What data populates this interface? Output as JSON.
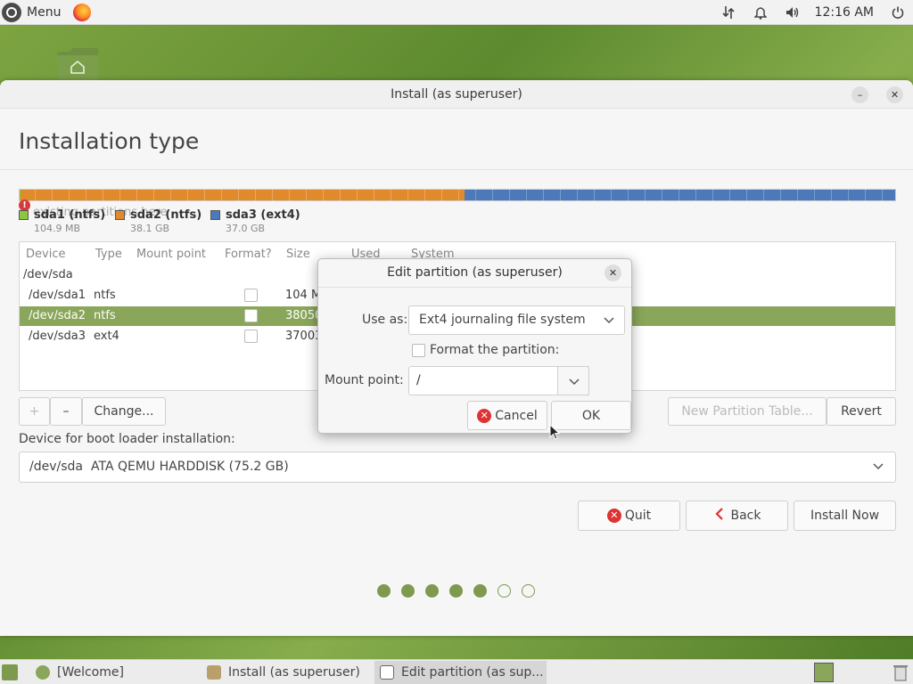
{
  "top_panel": {
    "menu_label": "Menu",
    "menu_icon": "ubuntu-logo-icon",
    "browser_icon": "firefox-icon",
    "tray_icons": [
      "network-icon",
      "bell-icon",
      "volume-icon"
    ],
    "clock": "12:16 AM",
    "power_icon": "power-icon"
  },
  "window": {
    "title": "Install (as superuser)",
    "minimize_symbol": "–",
    "close_symbol": "✕",
    "page_title": "Installation type",
    "warning_text": "existing partitions here",
    "partitions_bar": [
      {
        "name": "sda1 (ntfs)",
        "size": "104.9 MB",
        "color": "#8cc73f",
        "share": 0.0014
      },
      {
        "name": "sda2 (ntfs)",
        "size": "38.1 GB",
        "color": "#e08a2c",
        "share": 0.507
      },
      {
        "name": "sda3 (ext4)",
        "size": "37.0 GB",
        "color": "#4e79b8",
        "share": 0.4916
      }
    ],
    "table": {
      "headers": [
        "Device",
        "Type",
        "Mount point",
        "Format?",
        "Size",
        "Used",
        "System"
      ],
      "rows": [
        {
          "device": "/dev/sda",
          "type": "",
          "size": "",
          "checkbox": false,
          "selected": false
        },
        {
          "device": "/dev/sda1",
          "type": "ntfs",
          "size": "104 M",
          "checkbox": true,
          "selected": false
        },
        {
          "device": "/dev/sda2",
          "type": "ntfs",
          "size": "38050",
          "checkbox": true,
          "selected": true
        },
        {
          "device": "/dev/sda3",
          "type": "ext4",
          "size": "37003",
          "checkbox": true,
          "selected": false
        }
      ]
    },
    "table_buttons": {
      "add": "+",
      "remove": "–",
      "change": "Change...",
      "new_table": "New Partition Table...",
      "revert": "Revert"
    },
    "boot_loader": {
      "label": "Device for boot loader installation:",
      "device": "/dev/sda",
      "description": "ATA QEMU HARDDISK (75.2 GB)"
    },
    "nav_buttons": {
      "quit": "Quit",
      "back": "Back",
      "install_now": "Install Now"
    },
    "progress": {
      "total_steps": 7,
      "completed_steps": 5
    }
  },
  "dialog": {
    "title": "Edit partition (as superuser)",
    "close_symbol": "✕",
    "use_as_label": "Use as:",
    "use_as_value": "Ext4 journaling file system",
    "format_label": "Format the partition:",
    "format_checked": false,
    "mount_label": "Mount point:",
    "mount_value": "/",
    "cancel": "Cancel",
    "ok": "OK"
  },
  "taskbar": {
    "items": [
      {
        "label": "[Welcome]",
        "active": false
      },
      {
        "label": "Install (as superuser)",
        "active": false
      },
      {
        "label": "Edit partition (as sup...",
        "active": true
      }
    ]
  }
}
